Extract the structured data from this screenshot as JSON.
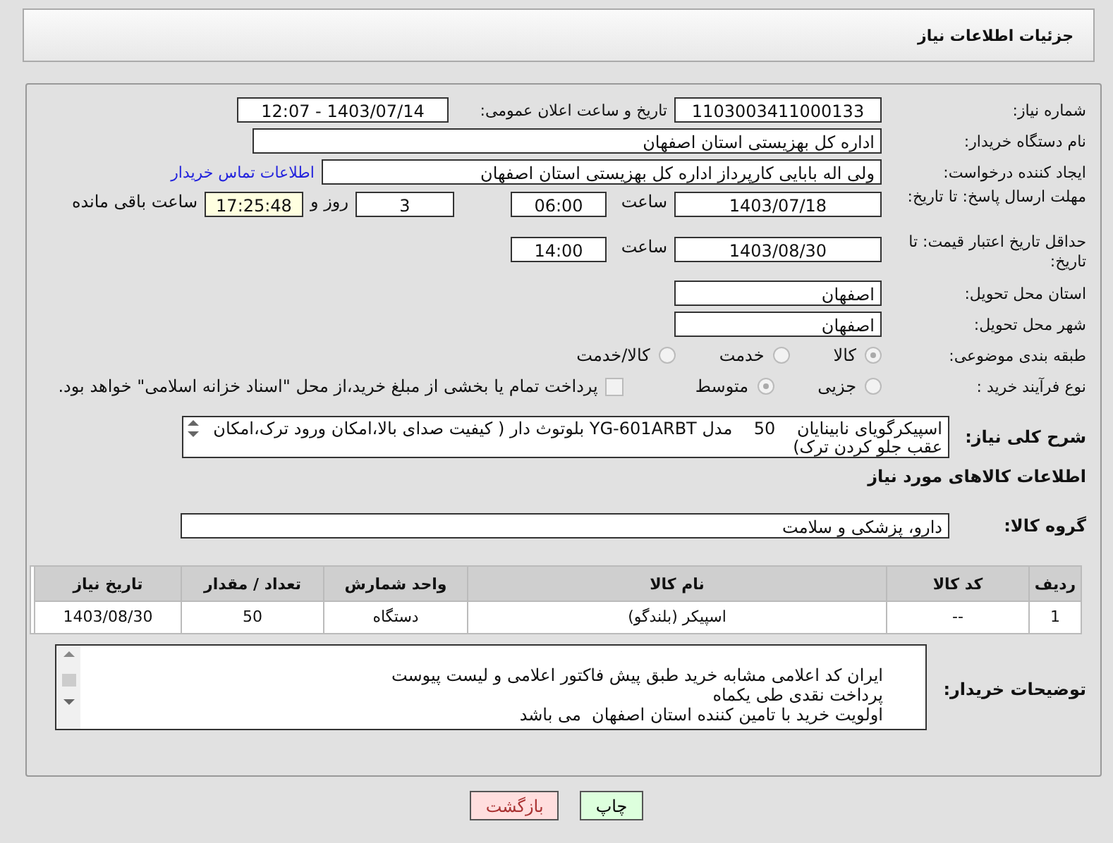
{
  "header": {
    "title": "جزئیات اطلاعات نیاز"
  },
  "need_number": {
    "label": "شماره نیاز:",
    "value": "1103003411000133"
  },
  "announce": {
    "label": "تاریخ و ساعت اعلان عمومی:",
    "value": "1403/07/14 - 12:07"
  },
  "buyer_org": {
    "label": "نام دستگاه خریدار:",
    "value": "اداره کل بهزیستی استان اصفهان"
  },
  "requester": {
    "label": "ایجاد کننده درخواست:",
    "value": "ولی اله بابایی کارپرداز اداره کل بهزیستی استان اصفهان",
    "link": "اطلاعات تماس خریدار"
  },
  "deadline": {
    "label": "مهلت ارسال پاسخ: تا تاریخ:",
    "date": "1403/07/18",
    "time_label": "ساعت",
    "time": "06:00",
    "days": "3",
    "days_label": "روز و",
    "remaining": "17:25:48",
    "remaining_label": "ساعت باقی مانده"
  },
  "validity": {
    "label": "حداقل تاریخ اعتبار قیمت: تا تاریخ:",
    "date": "1403/08/30",
    "time_label": "ساعت",
    "time": "14:00"
  },
  "province": {
    "label": "استان محل تحویل:",
    "value": "اصفهان"
  },
  "city": {
    "label": "شهر محل تحویل:",
    "value": "اصفهان"
  },
  "category": {
    "label": "طبقه بندی موضوعی:",
    "options": [
      {
        "label": "کالا",
        "selected": true
      },
      {
        "label": "خدمت",
        "selected": false
      },
      {
        "label": "کالا/خدمت",
        "selected": false
      }
    ]
  },
  "process": {
    "label": "نوع فرآیند خرید :",
    "options": [
      {
        "label": "جزیی",
        "selected": false
      },
      {
        "label": "متوسط",
        "selected": true
      }
    ],
    "treasury": {
      "label": "پرداخت تمام یا بخشی از مبلغ خرید،از محل \"اسناد خزانه اسلامی\" خواهد بود.",
      "checked": false
    }
  },
  "description": {
    "label": "شرح کلی نیاز:",
    "text": "اسپیکرگویای نابینایان    50    مدل YG-601ARBT بلوتوث دار ( کیفیت صدای بالا،امکان ورود ترک،امکان عقب جلو کردن ترک)"
  },
  "items_title": "اطلاعات کالاهای مورد نیاز",
  "goods_group": {
    "label": "گروه کالا:",
    "value": "دارو، پزشکی و سلامت"
  },
  "table": {
    "columns": [
      "ردیف",
      "کد کالا",
      "نام کالا",
      "واحد شمارش",
      "تعداد / مقدار",
      "تاریخ نیاز"
    ],
    "rows": [
      [
        "1",
        "--",
        "اسپیکر (بلندگو)",
        "دستگاه",
        "50",
        "1403/08/30"
      ]
    ]
  },
  "buyer_notes": {
    "label": "توضیحات خریدار:",
    "lines": [
      "ایران کد اعلامی مشابه خرید طبق پیش فاکتور اعلامی و لیست پیوست",
      "پرداخت نقدی طی یکماه",
      "اولویت خرید با تامین کننده استان اصفهان  می باشد"
    ]
  },
  "buttons": [
    {
      "label": "چاپ",
      "kind": "print"
    },
    {
      "label": "بازگشت",
      "kind": "back"
    }
  ]
}
